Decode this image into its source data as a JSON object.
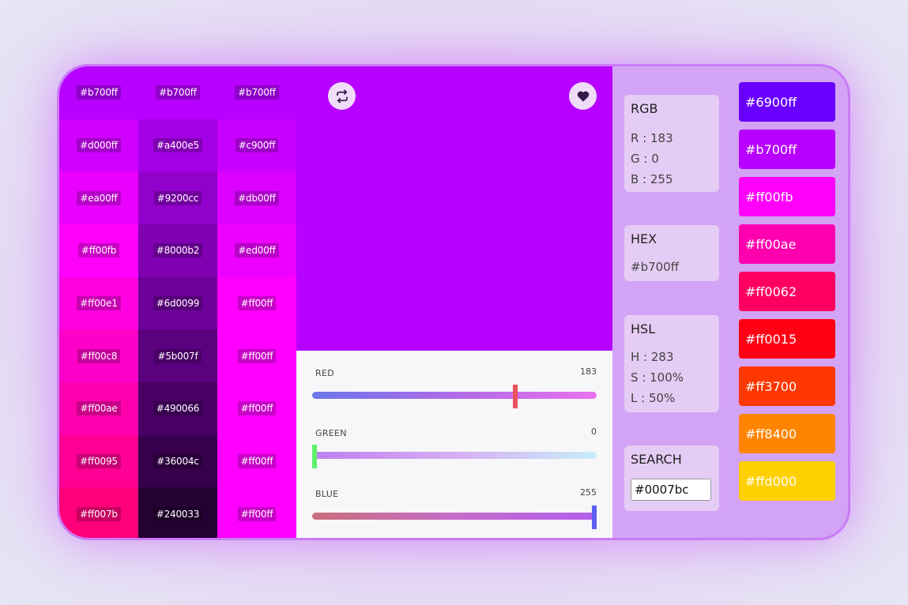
{
  "grid": {
    "cells": [
      {
        "hex": "#b700ff",
        "bg": "#b700ff"
      },
      {
        "hex": "#b700ff",
        "bg": "#b700ff"
      },
      {
        "hex": "#b700ff",
        "bg": "#b700ff"
      },
      {
        "hex": "#d000ff",
        "bg": "#d000ff"
      },
      {
        "hex": "#a400e5",
        "bg": "#a400e5"
      },
      {
        "hex": "#c900ff",
        "bg": "#c900ff"
      },
      {
        "hex": "#ea00ff",
        "bg": "#ea00ff"
      },
      {
        "hex": "#9200cc",
        "bg": "#9200cc"
      },
      {
        "hex": "#db00ff",
        "bg": "#db00ff"
      },
      {
        "hex": "#ff00fb",
        "bg": "#ff00fb"
      },
      {
        "hex": "#8000b2",
        "bg": "#8000b2"
      },
      {
        "hex": "#ed00ff",
        "bg": "#ed00ff"
      },
      {
        "hex": "#ff00e1",
        "bg": "#ff00e1"
      },
      {
        "hex": "#6d0099",
        "bg": "#6d0099"
      },
      {
        "hex": "#ff00ff",
        "bg": "#ff00ff"
      },
      {
        "hex": "#ff00c8",
        "bg": "#ff00c8"
      },
      {
        "hex": "#5b007f",
        "bg": "#5b007f"
      },
      {
        "hex": "#ff00ff",
        "bg": "#ff00ff"
      },
      {
        "hex": "#ff00ae",
        "bg": "#ff00ae"
      },
      {
        "hex": "#490066",
        "bg": "#490066"
      },
      {
        "hex": "#ff00ff",
        "bg": "#ff00ff"
      },
      {
        "hex": "#ff0095",
        "bg": "#ff0095"
      },
      {
        "hex": "#36004c",
        "bg": "#36004c"
      },
      {
        "hex": "#ff00ff",
        "bg": "#ff00ff"
      },
      {
        "hex": "#ff007b",
        "bg": "#ff007b"
      },
      {
        "hex": "#240033",
        "bg": "#240033"
      },
      {
        "hex": "#ff00ff",
        "bg": "#ff00ff"
      }
    ]
  },
  "preview": {
    "color": "#b700ff",
    "swap_icon": "swap-arrows-icon",
    "heart_icon": "heart-icon"
  },
  "sliders": {
    "red": {
      "label": "RED",
      "value": "183",
      "fraction": 0.718
    },
    "green": {
      "label": "GREEN",
      "value": "0",
      "fraction": 0.0
    },
    "blue": {
      "label": "BLUE",
      "value": "255",
      "fraction": 1.0
    }
  },
  "rgb": {
    "title": "RGB",
    "r": "R : 183",
    "g": "G : 0",
    "b": "B : 255"
  },
  "hex": {
    "title": "HEX",
    "value": "#b700ff"
  },
  "hsl": {
    "title": "HSL",
    "h": "H : 283",
    "s": "S : 100%",
    "l": "L : 50%"
  },
  "search": {
    "title": "SEARCH",
    "value": "#0007bc"
  },
  "palette": [
    {
      "hex": "#6900ff",
      "bg": "#6900ff"
    },
    {
      "hex": "#b700ff",
      "bg": "#b700ff"
    },
    {
      "hex": "#ff00fb",
      "bg": "#ff00fb"
    },
    {
      "hex": "#ff00ae",
      "bg": "#ff00ae"
    },
    {
      "hex": "#ff0062",
      "bg": "#ff0062"
    },
    {
      "hex": "#ff0015",
      "bg": "#ff0015"
    },
    {
      "hex": "#ff3700",
      "bg": "#ff3700"
    },
    {
      "hex": "#ff8400",
      "bg": "#ff8400"
    },
    {
      "hex": "#ffd000",
      "bg": "#ffd000"
    }
  ]
}
